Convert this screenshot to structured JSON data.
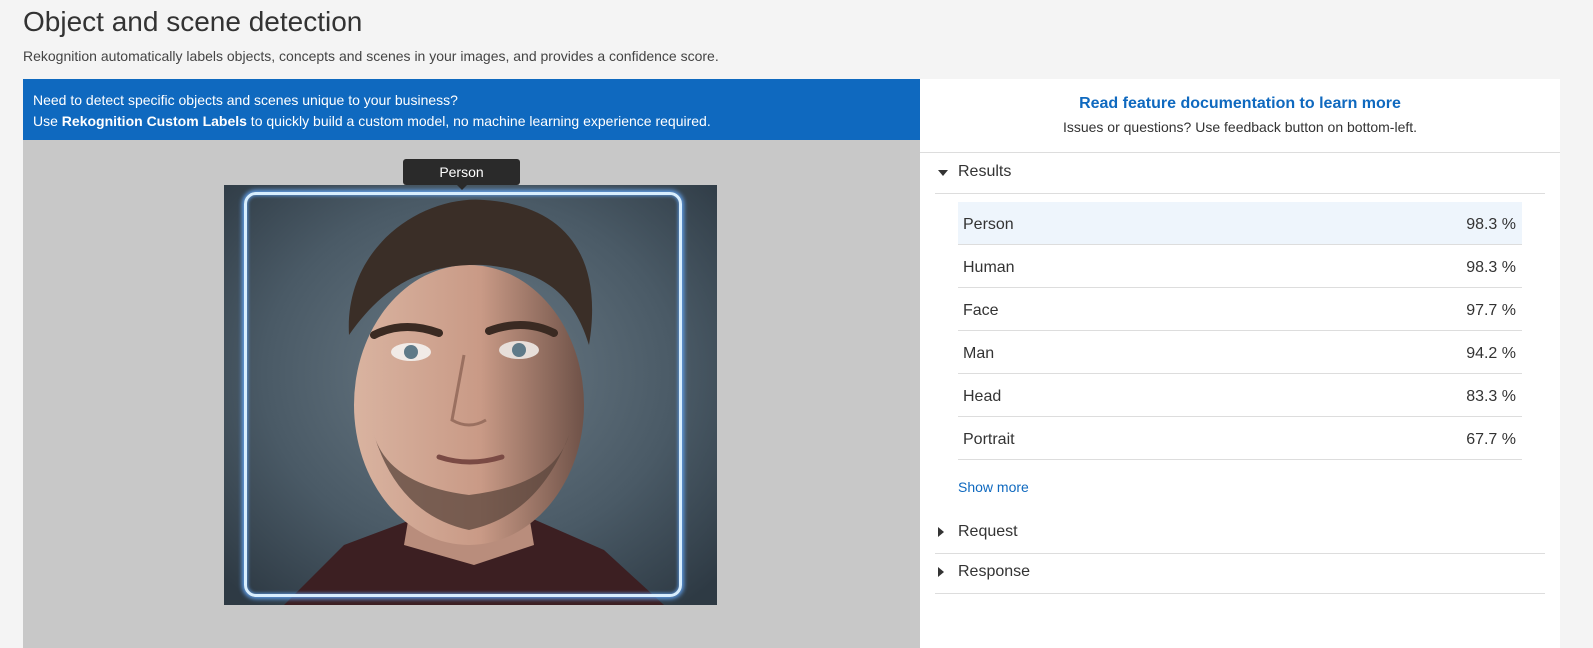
{
  "header": {
    "title": "Object and scene detection",
    "subtitle": "Rekognition automatically labels objects, concepts and scenes in your images, and provides a confidence score."
  },
  "banner": {
    "line1": "Need to detect specific objects and scenes unique to your business?",
    "line2_prefix": "Use ",
    "line2_link": "Rekognition Custom Labels",
    "line2_suffix": " to quickly build a custom model, no machine learning experience required.",
    "background": "#0f69bf"
  },
  "image": {
    "bbox_label": "Person",
    "description": "Portrait photo of a man with short hair and stubble against a gray-blue background"
  },
  "side": {
    "doc_link": "Read feature documentation to learn more",
    "doc_note": "Issues or questions? Use feedback button on bottom-left."
  },
  "sections": {
    "results": "Results",
    "request": "Request",
    "response": "Response"
  },
  "results": [
    {
      "label": "Person",
      "confidence": "98.3 %"
    },
    {
      "label": "Human",
      "confidence": "98.3 %"
    },
    {
      "label": "Face",
      "confidence": "97.7 %"
    },
    {
      "label": "Man",
      "confidence": "94.2 %"
    },
    {
      "label": "Head",
      "confidence": "83.3 %"
    },
    {
      "label": "Portrait",
      "confidence": "67.7 %"
    }
  ],
  "show_more": "Show more",
  "colors": {
    "accent": "#0f69bf",
    "selected_row": "#eef5fc",
    "bbox": "#d8eefe"
  }
}
